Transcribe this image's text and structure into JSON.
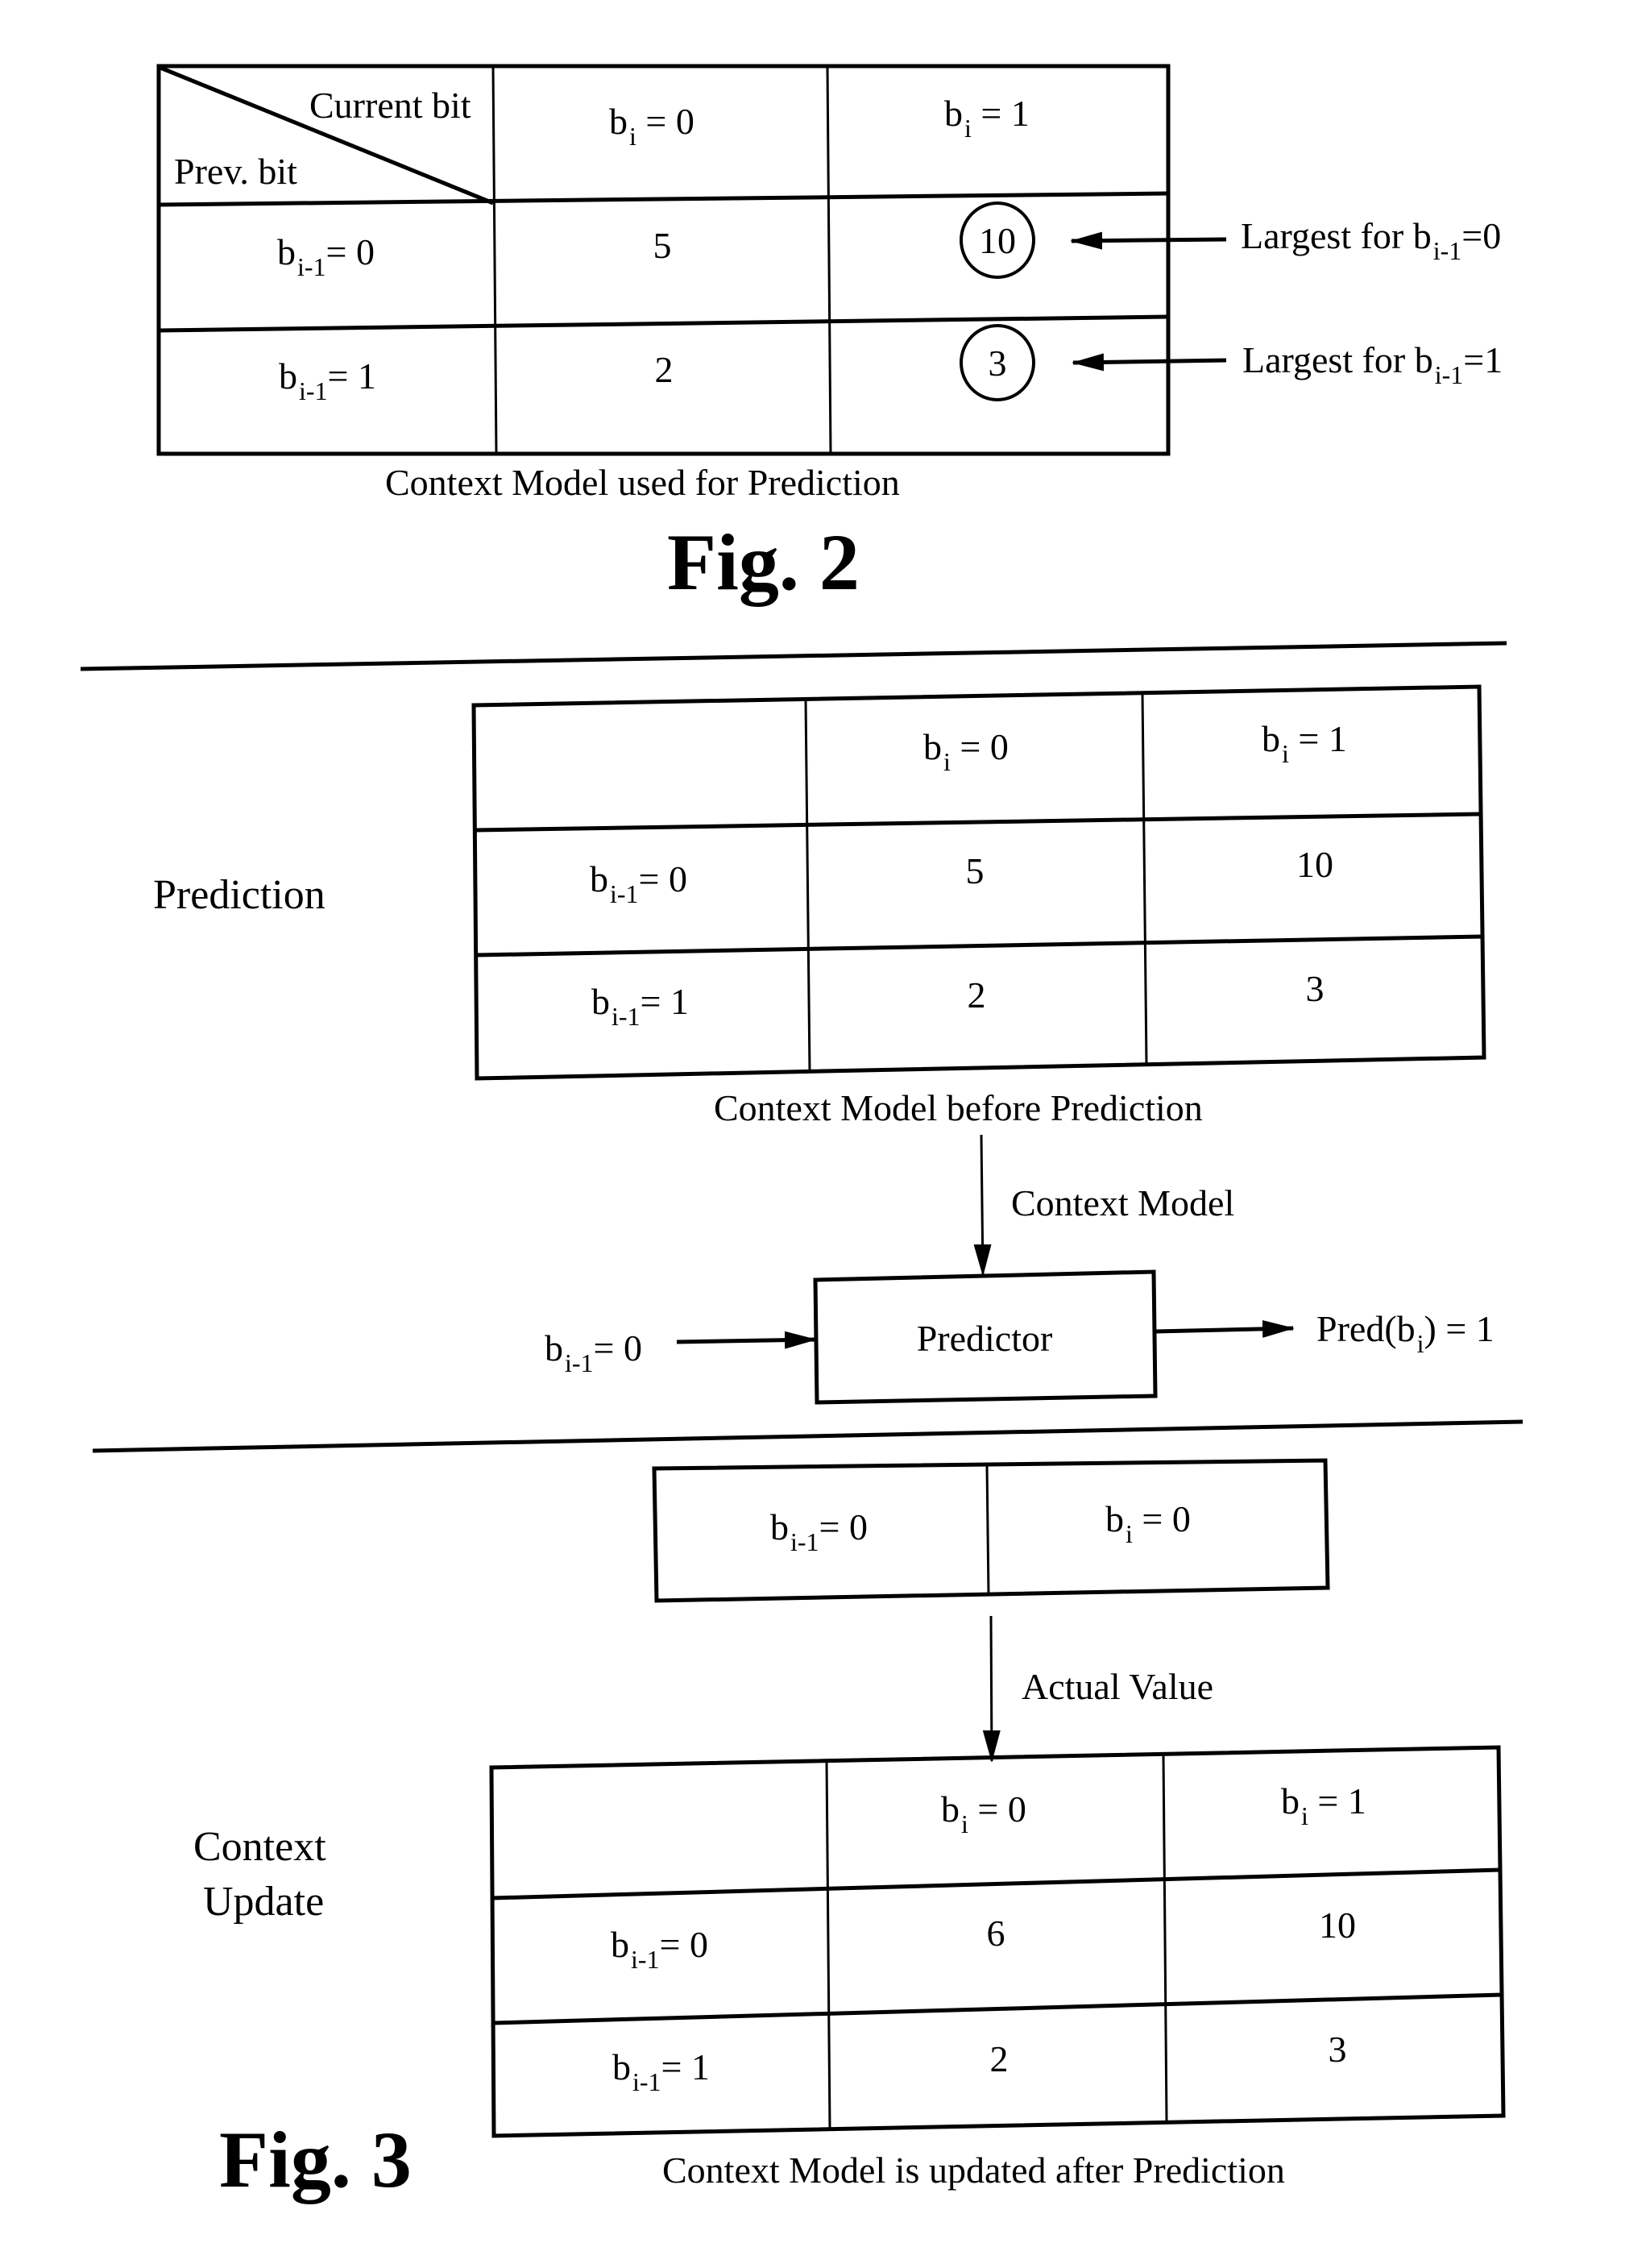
{
  "fig2": {
    "corner_top": "Current bit",
    "corner_bottom": "Prev. bit",
    "col_headers": [
      {
        "base": "b",
        "sub": "i",
        "rest": " = 0"
      },
      {
        "base": "b",
        "sub": "i",
        "rest": " = 1"
      }
    ],
    "rows": [
      {
        "label": {
          "base": "b",
          "sub": "i-1",
          "rest": "= 0"
        },
        "values": [
          "5",
          "10"
        ],
        "circled": [
          false,
          true
        ]
      },
      {
        "label": {
          "base": "b",
          "sub": "i-1",
          "rest": "= 1"
        },
        "values": [
          "2",
          "3"
        ],
        "circled": [
          false,
          true
        ]
      }
    ],
    "annotations": [
      {
        "prefix": "Largest for b",
        "sub": "i-1",
        "rest": "=0"
      },
      {
        "prefix": "Largest for b",
        "sub": "i-1",
        "rest": "=1"
      }
    ],
    "caption": "Context Model used for Prediction",
    "title": "Fig. 2"
  },
  "fig3": {
    "prediction": {
      "section_label": "Prediction",
      "col_headers": [
        {
          "base": "b",
          "sub": "i",
          "rest": " = 0"
        },
        {
          "base": "b",
          "sub": "i",
          "rest": " = 1"
        }
      ],
      "rows": [
        {
          "label": {
            "base": "b",
            "sub": "i-1",
            "rest": "= 0"
          },
          "values": [
            "5",
            "10"
          ]
        },
        {
          "label": {
            "base": "b",
            "sub": "i-1",
            "rest": "= 1"
          },
          "values": [
            "2",
            "3"
          ]
        }
      ],
      "caption": "Context Model before Prediction",
      "arrow_label": "Context Model",
      "predictor_label": "Predictor",
      "input": {
        "base": "b",
        "sub": "i-1",
        "rest": "= 0"
      },
      "output": {
        "prefix": "Pred(b",
        "sub": "i",
        "rest": ") = 1"
      }
    },
    "actual": {
      "cells": [
        {
          "base": "b",
          "sub": "i-1",
          "rest": "= 0"
        },
        {
          "base": "b",
          "sub": "i",
          "rest": " = 0"
        }
      ],
      "arrow_label": "Actual Value"
    },
    "update": {
      "section_label_line1": "Context",
      "section_label_line2": "Update",
      "col_headers": [
        {
          "base": "b",
          "sub": "i",
          "rest": " = 0"
        },
        {
          "base": "b",
          "sub": "i",
          "rest": " = 1"
        }
      ],
      "rows": [
        {
          "label": {
            "base": "b",
            "sub": "i-1",
            "rest": "= 0"
          },
          "values": [
            "6",
            "10"
          ]
        },
        {
          "label": {
            "base": "b",
            "sub": "i-1",
            "rest": "= 1"
          },
          "values": [
            "2",
            "3"
          ]
        }
      ],
      "caption": "Context Model is updated after Prediction"
    },
    "title": "Fig. 3"
  }
}
